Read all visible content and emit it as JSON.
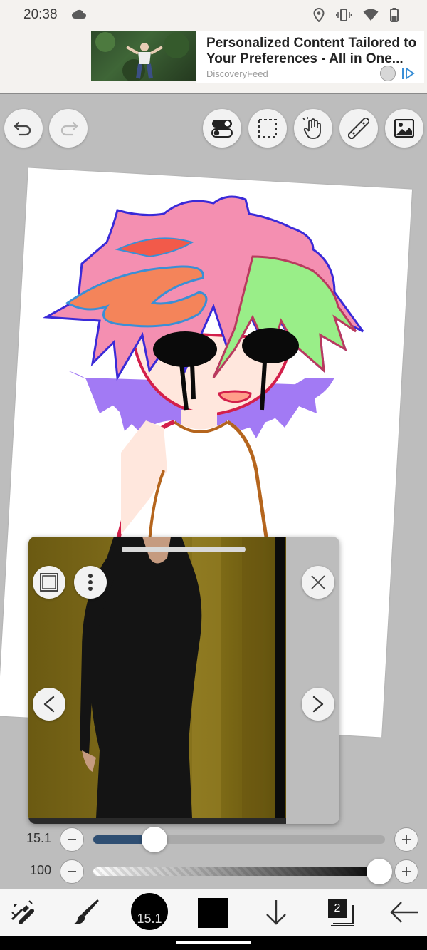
{
  "status_bar": {
    "time": "20:38",
    "icons": [
      "cloud-icon",
      "location-icon",
      "vibrate-icon",
      "wifi-icon",
      "battery-icon"
    ]
  },
  "ad": {
    "headline_line1": "Personalized Content Tailored to",
    "headline_line2": "Your Preferences - All in One...",
    "source": "DiscoveryFeed"
  },
  "top_toolbar": {
    "left": [
      "undo-icon",
      "redo-icon"
    ],
    "right": [
      "toggle-icon",
      "selection-icon",
      "hand-icon",
      "ruler-icon",
      "image-icon"
    ]
  },
  "reference_window": {
    "buttons": [
      "frame-icon",
      "more-icon",
      "close-icon",
      "prev-icon",
      "next-icon"
    ]
  },
  "brush_size_slider": {
    "value_label": "15.1",
    "fraction": 0.21
  },
  "opacity_slider": {
    "value_label": "100",
    "fraction": 0.98
  },
  "bottom_bar": {
    "brush_size_label": "15.1",
    "layers_count": "2",
    "current_color": "#000000",
    "tools": [
      "transform-icon",
      "brush-icon",
      "brush-size",
      "color-swatch",
      "download-icon",
      "layers-icon",
      "back-arrow-icon"
    ]
  },
  "colors": {
    "slider_fill": "#2f4f73",
    "background": "#bdbdbd"
  }
}
